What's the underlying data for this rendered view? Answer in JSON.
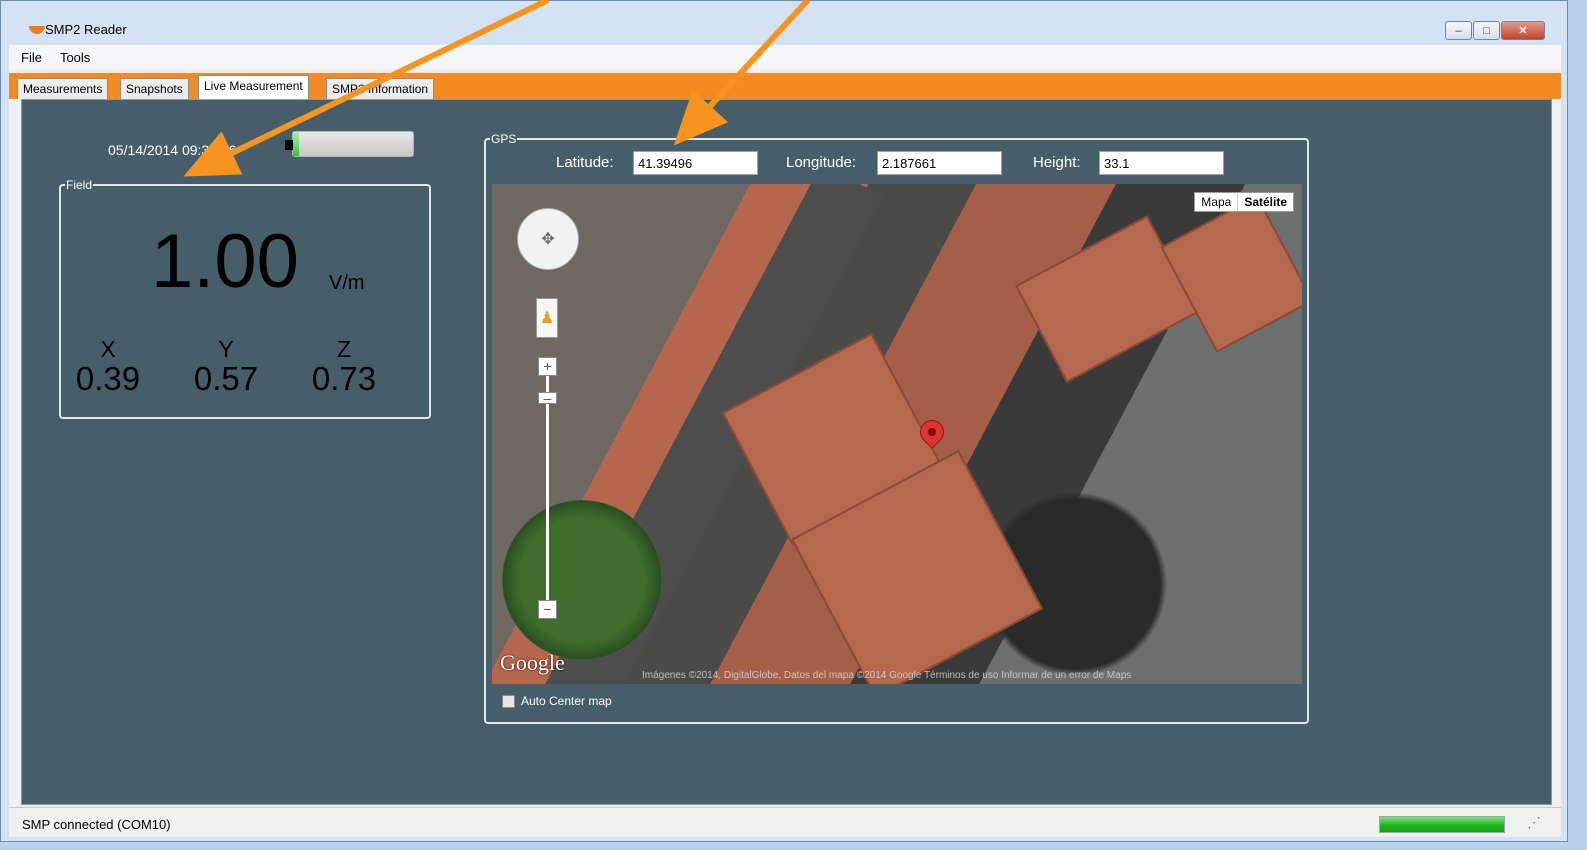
{
  "window": {
    "title": "SMP2 Reader",
    "min": "–",
    "max": "□",
    "close": "✕"
  },
  "menu": {
    "file": "File",
    "tools": "Tools"
  },
  "tabs": [
    {
      "label": "Measurements",
      "active": false
    },
    {
      "label": "Snapshots",
      "active": false
    },
    {
      "label": "Live Measurement",
      "active": true
    },
    {
      "label": "SMP2 Information",
      "active": false
    }
  ],
  "live": {
    "datetime": "05/14/2014 09:33:06",
    "battery_level": 0.05,
    "field": {
      "legend": "Field",
      "value": "1.00",
      "unit": "V/m",
      "x_label": "X",
      "x_value": "0.39",
      "y_label": "Y",
      "y_value": "0.57",
      "z_label": "Z",
      "z_value": "0.73"
    }
  },
  "gps": {
    "legend": "GPS",
    "latitude_label": "Latitude:",
    "latitude": "41.39496",
    "longitude_label": "Longitude:",
    "longitude": "2.187661",
    "height_label": "Height:",
    "height": "33.1",
    "map": {
      "type_map": "Mapa",
      "type_satellite": "Satélite",
      "logo": "Google",
      "attribution": "Imágenes ©2014, DigitalGlobe, Datos del mapa ©2014 Google  Términos de uso  Informar de un error de Maps",
      "zoom_in": "+",
      "zoom_out": "−"
    },
    "auto_center_label": "Auto Center map",
    "auto_center_checked": false
  },
  "status": {
    "text": "SMP connected (COM10)",
    "progress": 1.0
  },
  "colors": {
    "tab_strip": "#f58a22",
    "stage": "#465e69",
    "arrow": "#f7941d"
  }
}
